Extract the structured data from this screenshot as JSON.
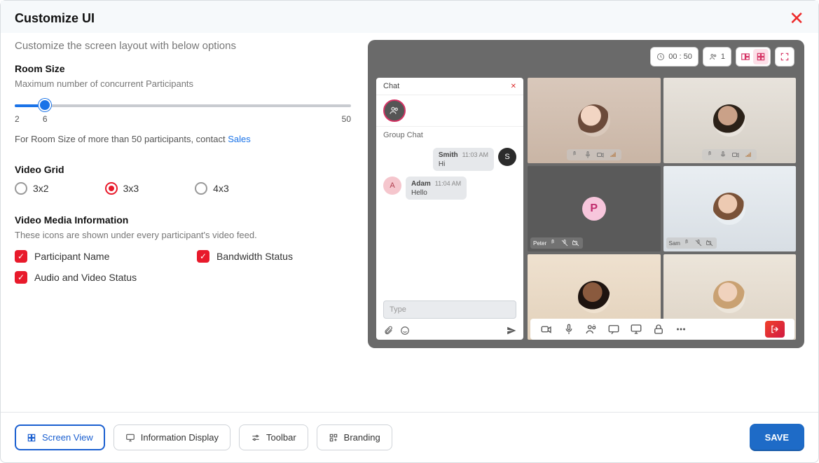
{
  "header": {
    "title": "Customize UI"
  },
  "subtitle": "Customize the screen layout with below options",
  "roomSize": {
    "title": "Room Size",
    "desc": "Maximum number of concurrent Participants",
    "min": "2",
    "max": "50",
    "value": "6",
    "note_prefix": "For Room Size of more than 50 participants, contact ",
    "note_link": "Sales"
  },
  "videoGrid": {
    "title": "Video Grid",
    "options": [
      "3x2",
      "3x3",
      "4x3"
    ],
    "selected": 1
  },
  "mediaInfo": {
    "title": "Video Media Information",
    "desc": "These icons are shown under every participant's video feed.",
    "checks": [
      "Participant Name",
      "Bandwidth Status",
      "Audio and Video Status"
    ]
  },
  "preview": {
    "timer": "00 : 50",
    "participants": "1",
    "chat": {
      "title": "Chat",
      "group_label": "Group Chat",
      "messages": [
        {
          "side": "right",
          "initial": "S",
          "name": "Smith",
          "time": "11:03 AM",
          "text": "Hi",
          "avbg": "#2b2b2b"
        },
        {
          "side": "left",
          "initial": "A",
          "name": "Adam",
          "time": "11:04 AM",
          "text": "Hello",
          "avbg": "#f5c6cd"
        }
      ],
      "input_placeholder": "Type"
    },
    "tiles": {
      "peter_initial": "P",
      "names": {
        "peter": "Peter",
        "sam": "Sam"
      }
    }
  },
  "footer": {
    "tabs": [
      "Screen View",
      "Information Display",
      "Toolbar",
      "Branding"
    ],
    "active": 0,
    "save": "SAVE"
  }
}
